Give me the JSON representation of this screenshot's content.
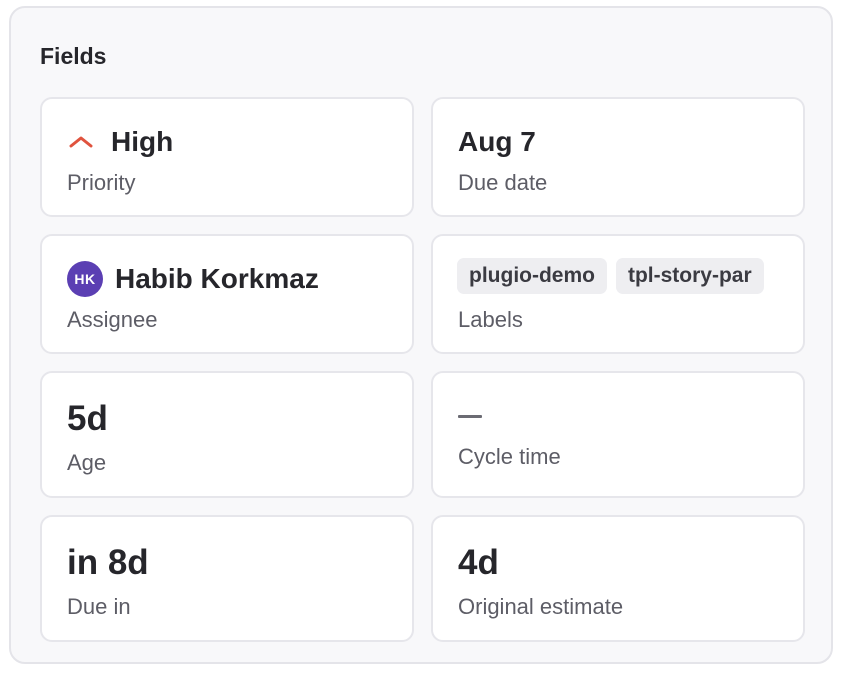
{
  "panel": {
    "title": "Fields"
  },
  "fields": {
    "priority": {
      "value": "High",
      "label": "Priority",
      "icon": "chevron-up-icon",
      "icon_color": "#e0533e"
    },
    "due_date": {
      "value": "Aug 7",
      "label": "Due date"
    },
    "assignee": {
      "initials": "HK",
      "name": "Habib Korkmaz",
      "label": "Assignee",
      "avatar_color": "#5b3fb3"
    },
    "labels": {
      "chips": [
        "plugio-demo",
        "tpl-story-par"
      ],
      "label": "Labels"
    },
    "age": {
      "value": "5d",
      "label": "Age"
    },
    "cycle_time": {
      "value": "—",
      "label": "Cycle time"
    },
    "due_in": {
      "value": "in 8d",
      "label": "Due in"
    },
    "original_estimate": {
      "value": "4d",
      "label": "Original estimate"
    }
  }
}
